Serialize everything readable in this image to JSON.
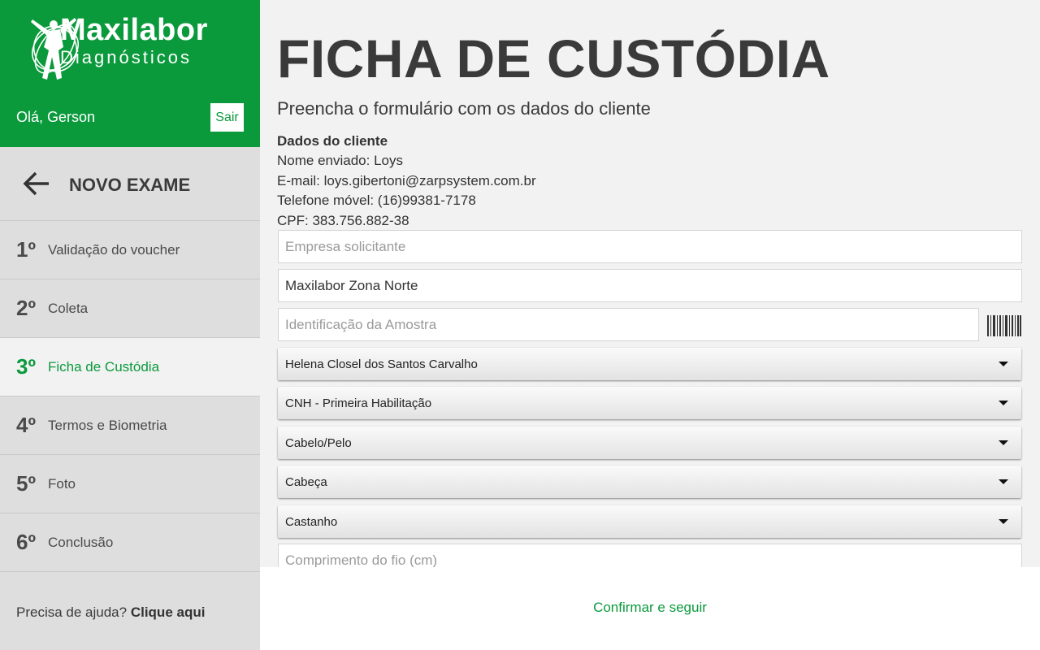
{
  "brand": {
    "name": "Maxilabor",
    "sub": "Diagnósticos",
    "accent": "#0a9a3c"
  },
  "user": {
    "greeting": "Olá, Gerson",
    "logout_label": "Sair"
  },
  "nav": {
    "back_title": "NOVO EXAME"
  },
  "steps": [
    {
      "num": "1º",
      "label": "Validação do voucher"
    },
    {
      "num": "2º",
      "label": "Coleta"
    },
    {
      "num": "3º",
      "label": "Ficha de Custódia"
    },
    {
      "num": "4º",
      "label": "Termos e Biometria"
    },
    {
      "num": "5º",
      "label": "Foto"
    },
    {
      "num": "6º",
      "label": "Conclusão"
    }
  ],
  "help": {
    "text": "Precisa de ajuda?",
    "link": "Clique aqui"
  },
  "page": {
    "title": "FICHA DE CUSTÓDIA",
    "subtitle": "Preencha o formulário com os dados do cliente"
  },
  "client": {
    "heading": "Dados do cliente",
    "name": "Nome enviado: Loys",
    "email": "E-mail: loys.gibertoni@zarpsystem.com.br",
    "phone": "Telefone móvel: (16)99381-7178",
    "cpf": "CPF: 383.756.882-38"
  },
  "form": {
    "company_placeholder": "Empresa solicitante",
    "company_value": "",
    "unit_value": "Maxilabor Zona Norte",
    "sample_placeholder": "Identificação da Amostra",
    "sample_value": "",
    "collector": "Helena Closel dos Santos Carvalho",
    "reason": "CNH - Primeira Habilitação",
    "material": "Cabelo/Pelo",
    "region": "Cabeça",
    "color": "Castanho",
    "length_placeholder": "Comprimento do fio (cm)"
  },
  "footer": {
    "confirm_label": "Confirmar e seguir"
  }
}
